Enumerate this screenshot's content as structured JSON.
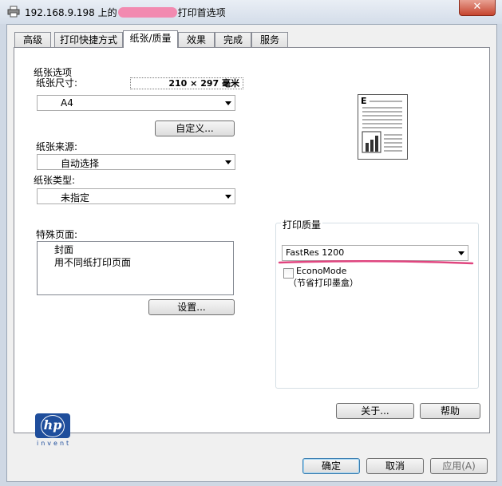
{
  "window": {
    "title_prefix": "192.168.9.198 上的",
    "title_suffix": "打印首选项",
    "close_label": "✕"
  },
  "tabs": [
    {
      "label": "高级"
    },
    {
      "label": "打印快捷方式"
    },
    {
      "label": "纸张/质量",
      "active": true
    },
    {
      "label": "效果"
    },
    {
      "label": "完成"
    },
    {
      "label": "服务"
    }
  ],
  "paper_options": {
    "group_label": "纸张选项",
    "size_label": "纸张尺寸:",
    "size_readout": "210 × 297 毫米",
    "size_value": "A4",
    "custom_button": "自定义...",
    "source_label": "纸张来源:",
    "source_value": "自动选择",
    "type_label": "纸张类型:",
    "type_value": "未指定"
  },
  "special_pages": {
    "label": "特殊页面:",
    "items": [
      "封面",
      "用不同纸打印页面"
    ],
    "settings_button": "设置..."
  },
  "preview": {
    "letter": "E"
  },
  "print_quality": {
    "group_label": "打印质量",
    "value": "FastRes 1200",
    "economode_label": "EconoMode",
    "economode_hint": "（节省打印墨盒）",
    "economode_checked": false
  },
  "brand": {
    "logo_text": "hp",
    "tagline": "invent"
  },
  "panel_buttons": {
    "about": "关于...",
    "help": "帮助"
  },
  "dialog_buttons": {
    "ok": "确定",
    "cancel": "取消",
    "apply": "应用(A)"
  },
  "colors": {
    "annotation": "#e0457f",
    "hp_blue": "#1f4e9c"
  }
}
